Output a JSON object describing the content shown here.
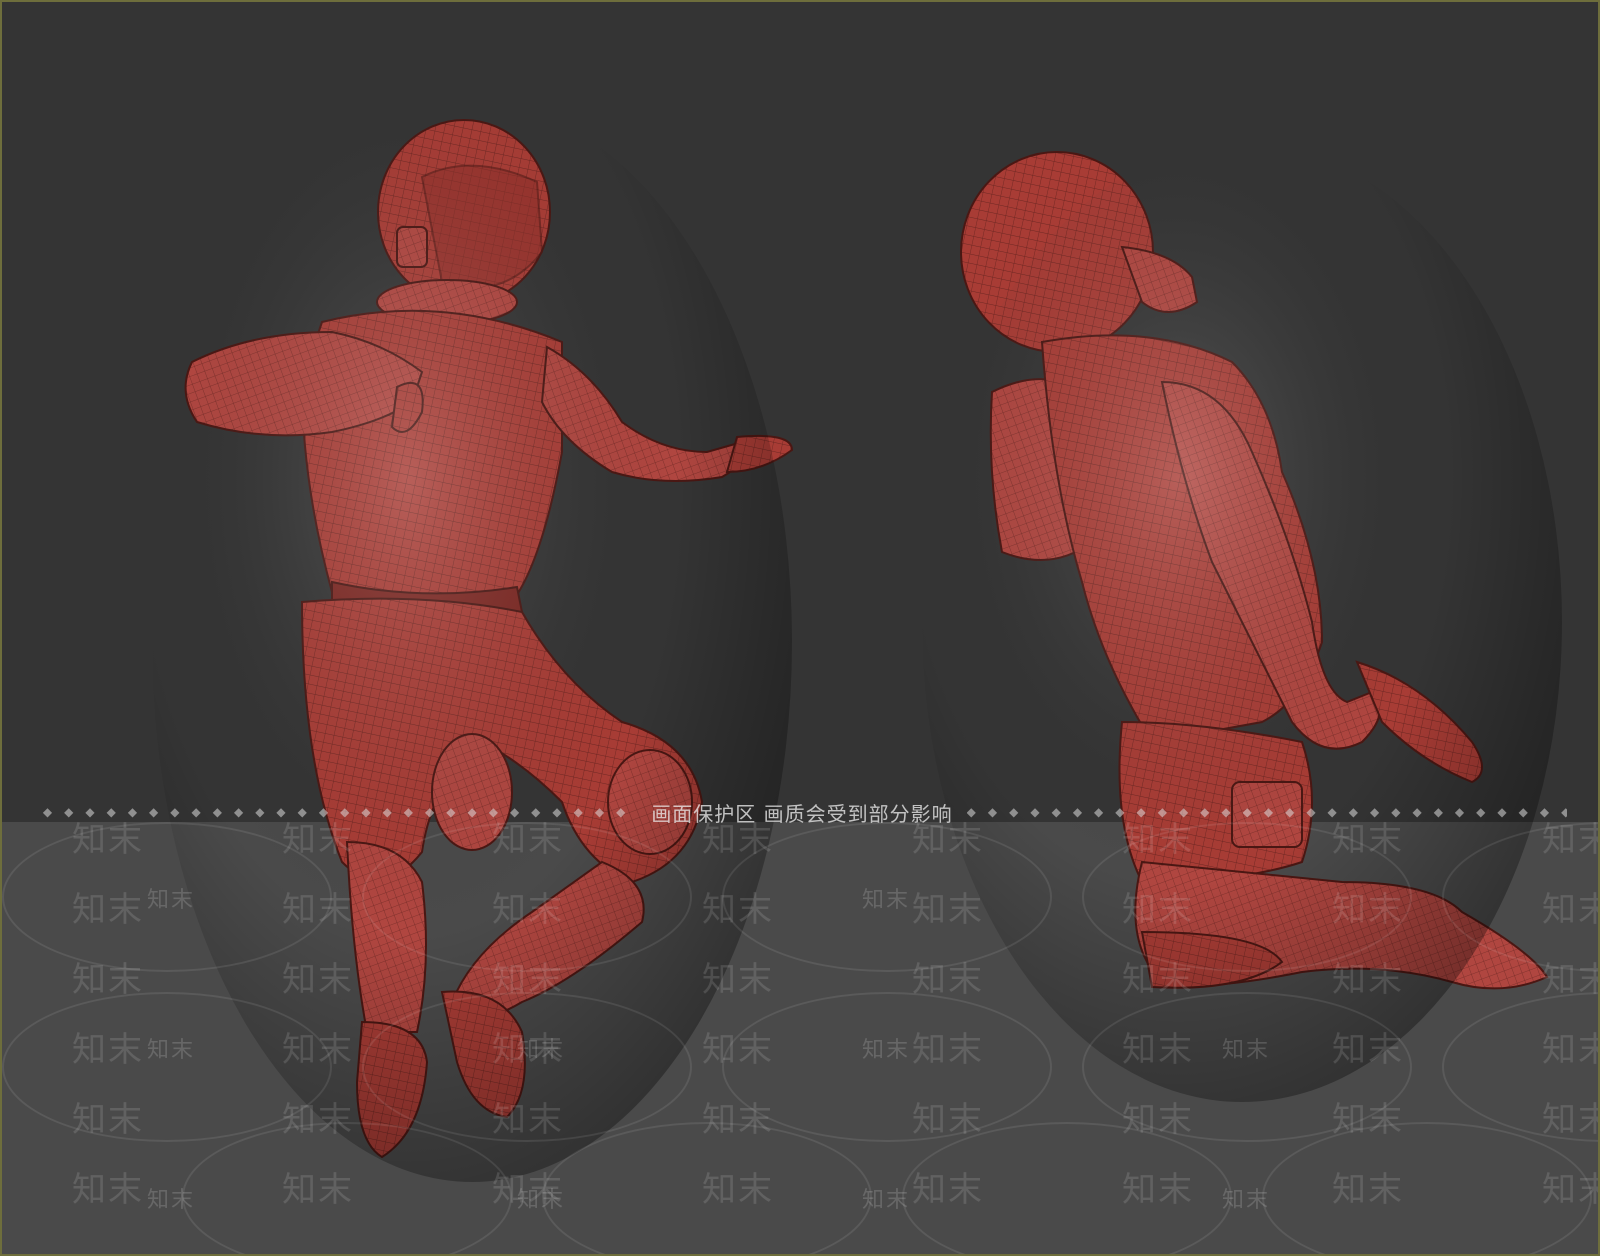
{
  "scene": {
    "subject": "",
    "background_color": "#343434",
    "floor_band_color": "#4a4a4a",
    "mesh_color": "#b0413a",
    "wire_color": "#5a1f1b"
  },
  "notice": {
    "text": "画面保护区  画质会受到部分影响",
    "dots": "◆◆◆◆◆◆◆◆◆◆◆◆◆◆◆◆◆◆◆◆◆◆◆◆◆◆◆◆◆◆"
  },
  "watermark": {
    "large_text": "知末",
    "small_text": "知末"
  }
}
